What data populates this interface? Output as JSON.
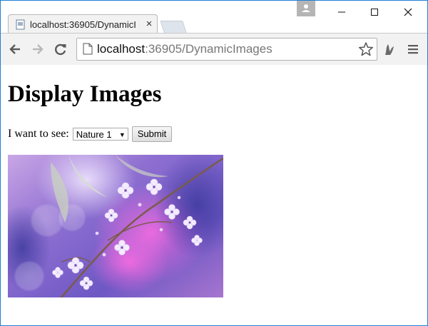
{
  "browser": {
    "tab": {
      "title": "localhost:36905/DynamicI",
      "close_label": "×"
    },
    "address_bar": {
      "host": "localhost",
      "path": ":36905/DynamicImages"
    },
    "accent_color": "#1e7fd4"
  },
  "page": {
    "heading": "Display Images",
    "form": {
      "label": "I want to see:",
      "select_value": "Nature 1",
      "submit_label": "Submit"
    },
    "image": {
      "subject": "purple blossoms on a branch",
      "icon": "photo-image"
    }
  }
}
